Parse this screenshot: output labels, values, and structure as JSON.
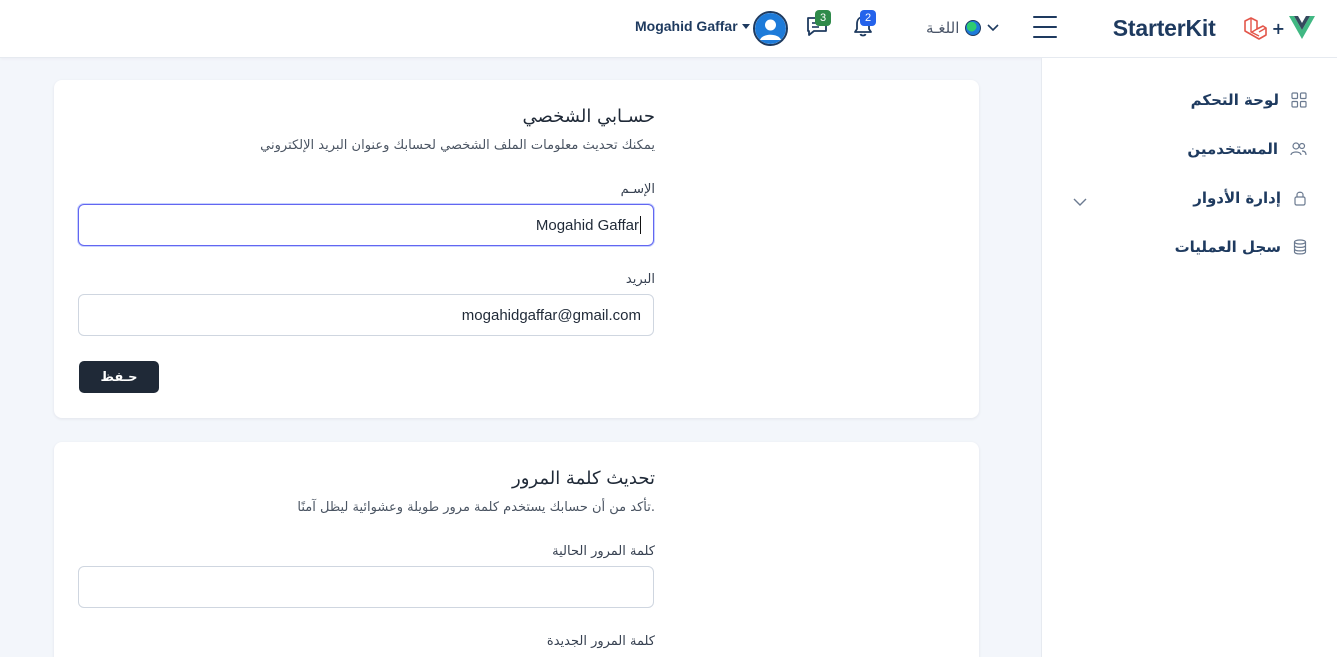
{
  "header": {
    "brand_title": "StarterKit",
    "brand_plus": "+",
    "language_label": "اللغـة",
    "user_name": "Mogahid Gaffar",
    "messages_count": "3",
    "notifications_count": "2"
  },
  "sidebar": {
    "items": [
      {
        "label": "لوحة التحكم",
        "icon": "grid-icon"
      },
      {
        "label": "المستخدمين",
        "icon": "users-icon"
      },
      {
        "label": "إدارة الأدوار",
        "icon": "lock-icon"
      },
      {
        "label": "سجل العمليات",
        "icon": "database-icon"
      }
    ]
  },
  "profile": {
    "title": "حسـابي الشخصي",
    "description": "يمكنك تحديث معلومات الملف الشخصي لحسابك وعنوان البريد الإلكتروني",
    "name_label": "الإسـم",
    "name_value": "Mogahid Gaffar",
    "email_label": "البريد",
    "email_value": "mogahidgaffar@gmail.com",
    "save_label": "حـفظ"
  },
  "password": {
    "title": "تحديث كلمة المرور",
    "description": ".تأكد من أن حسابك يستخدم كلمة مرور طويلة وعشوائية ليظل آمنًا",
    "current_label": "كلمة المرور الحالية",
    "current_value": "",
    "new_label": "كلمة المرور الجديدة"
  },
  "colors": {
    "primary": "#1e3a5f",
    "button": "#1f2937",
    "badge_green": "#2f8a4a",
    "badge_blue": "#2563eb",
    "focus_border": "#6366f1"
  }
}
